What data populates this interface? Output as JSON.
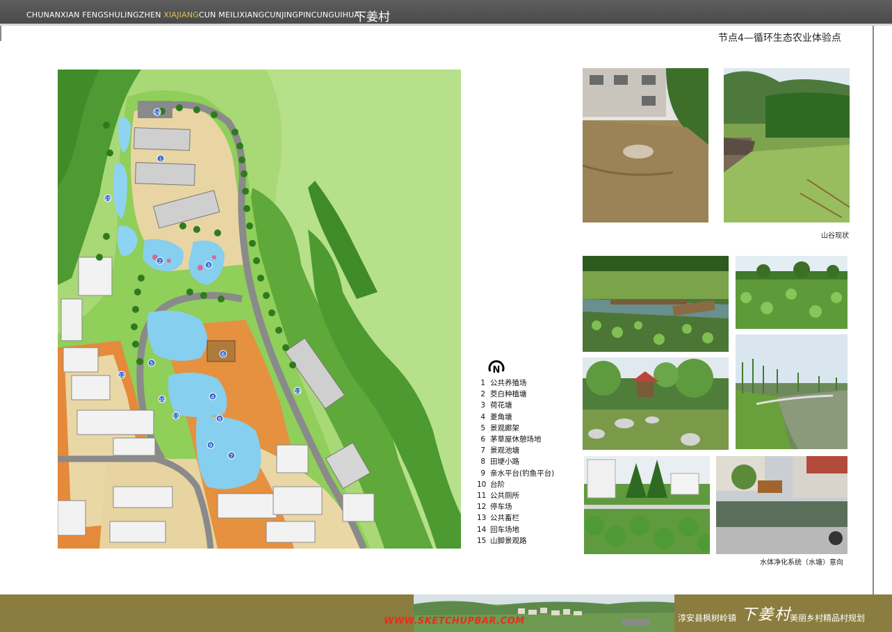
{
  "header": {
    "pinyin_prefix": "CHUNANXIAN FENGSHULINGZHEN ",
    "pinyin_highlight_a": "XIAJIANG",
    "pinyin_mid": "CUN MEILIXIANGCUNJINGPINCUNGUIHUA",
    "village_title": "下姜村"
  },
  "node_title": "节点4—循环生态农业体验点",
  "north_label": "N",
  "legend": [
    {
      "num": "1",
      "label": "公共养殖场"
    },
    {
      "num": "2",
      "label": "茭白种植塘"
    },
    {
      "num": "3",
      "label": "荷花塘"
    },
    {
      "num": "4",
      "label": "菱角塘"
    },
    {
      "num": "5",
      "label": "景观廊架"
    },
    {
      "num": "6",
      "label": "茅草屋休憩场地"
    },
    {
      "num": "7",
      "label": "景观池塘"
    },
    {
      "num": "8",
      "label": "田埂小路"
    },
    {
      "num": "9",
      "label": "亲水平台(钓鱼平台)"
    },
    {
      "num": "10",
      "label": "台阶"
    },
    {
      "num": "11",
      "label": "公共厕所"
    },
    {
      "num": "12",
      "label": "停车场"
    },
    {
      "num": "13",
      "label": "公共畜栏"
    },
    {
      "num": "14",
      "label": "回车场地"
    },
    {
      "num": "15",
      "label": "山脚景观路"
    }
  ],
  "plan_numbers": [
    "1",
    "2",
    "3",
    "4",
    "5",
    "6",
    "7",
    "8",
    "9",
    "10",
    "11",
    "12",
    "13",
    "14",
    "15"
  ],
  "captions": {
    "valley": "山谷现状",
    "water": "水体净化系统（水塘）意向"
  },
  "footer": {
    "county": "淳安县枫树岭镇",
    "script_title": "下姜村",
    "plan_name": "美丽乡村精品村规划",
    "watermark": "WWW.SKETCHUPBAR.COM"
  },
  "colors": {
    "topbar": "#4f4f4f",
    "highlight": "#e0c24a",
    "footer": "#8b7d3f",
    "watermark": "#e82e1c"
  }
}
